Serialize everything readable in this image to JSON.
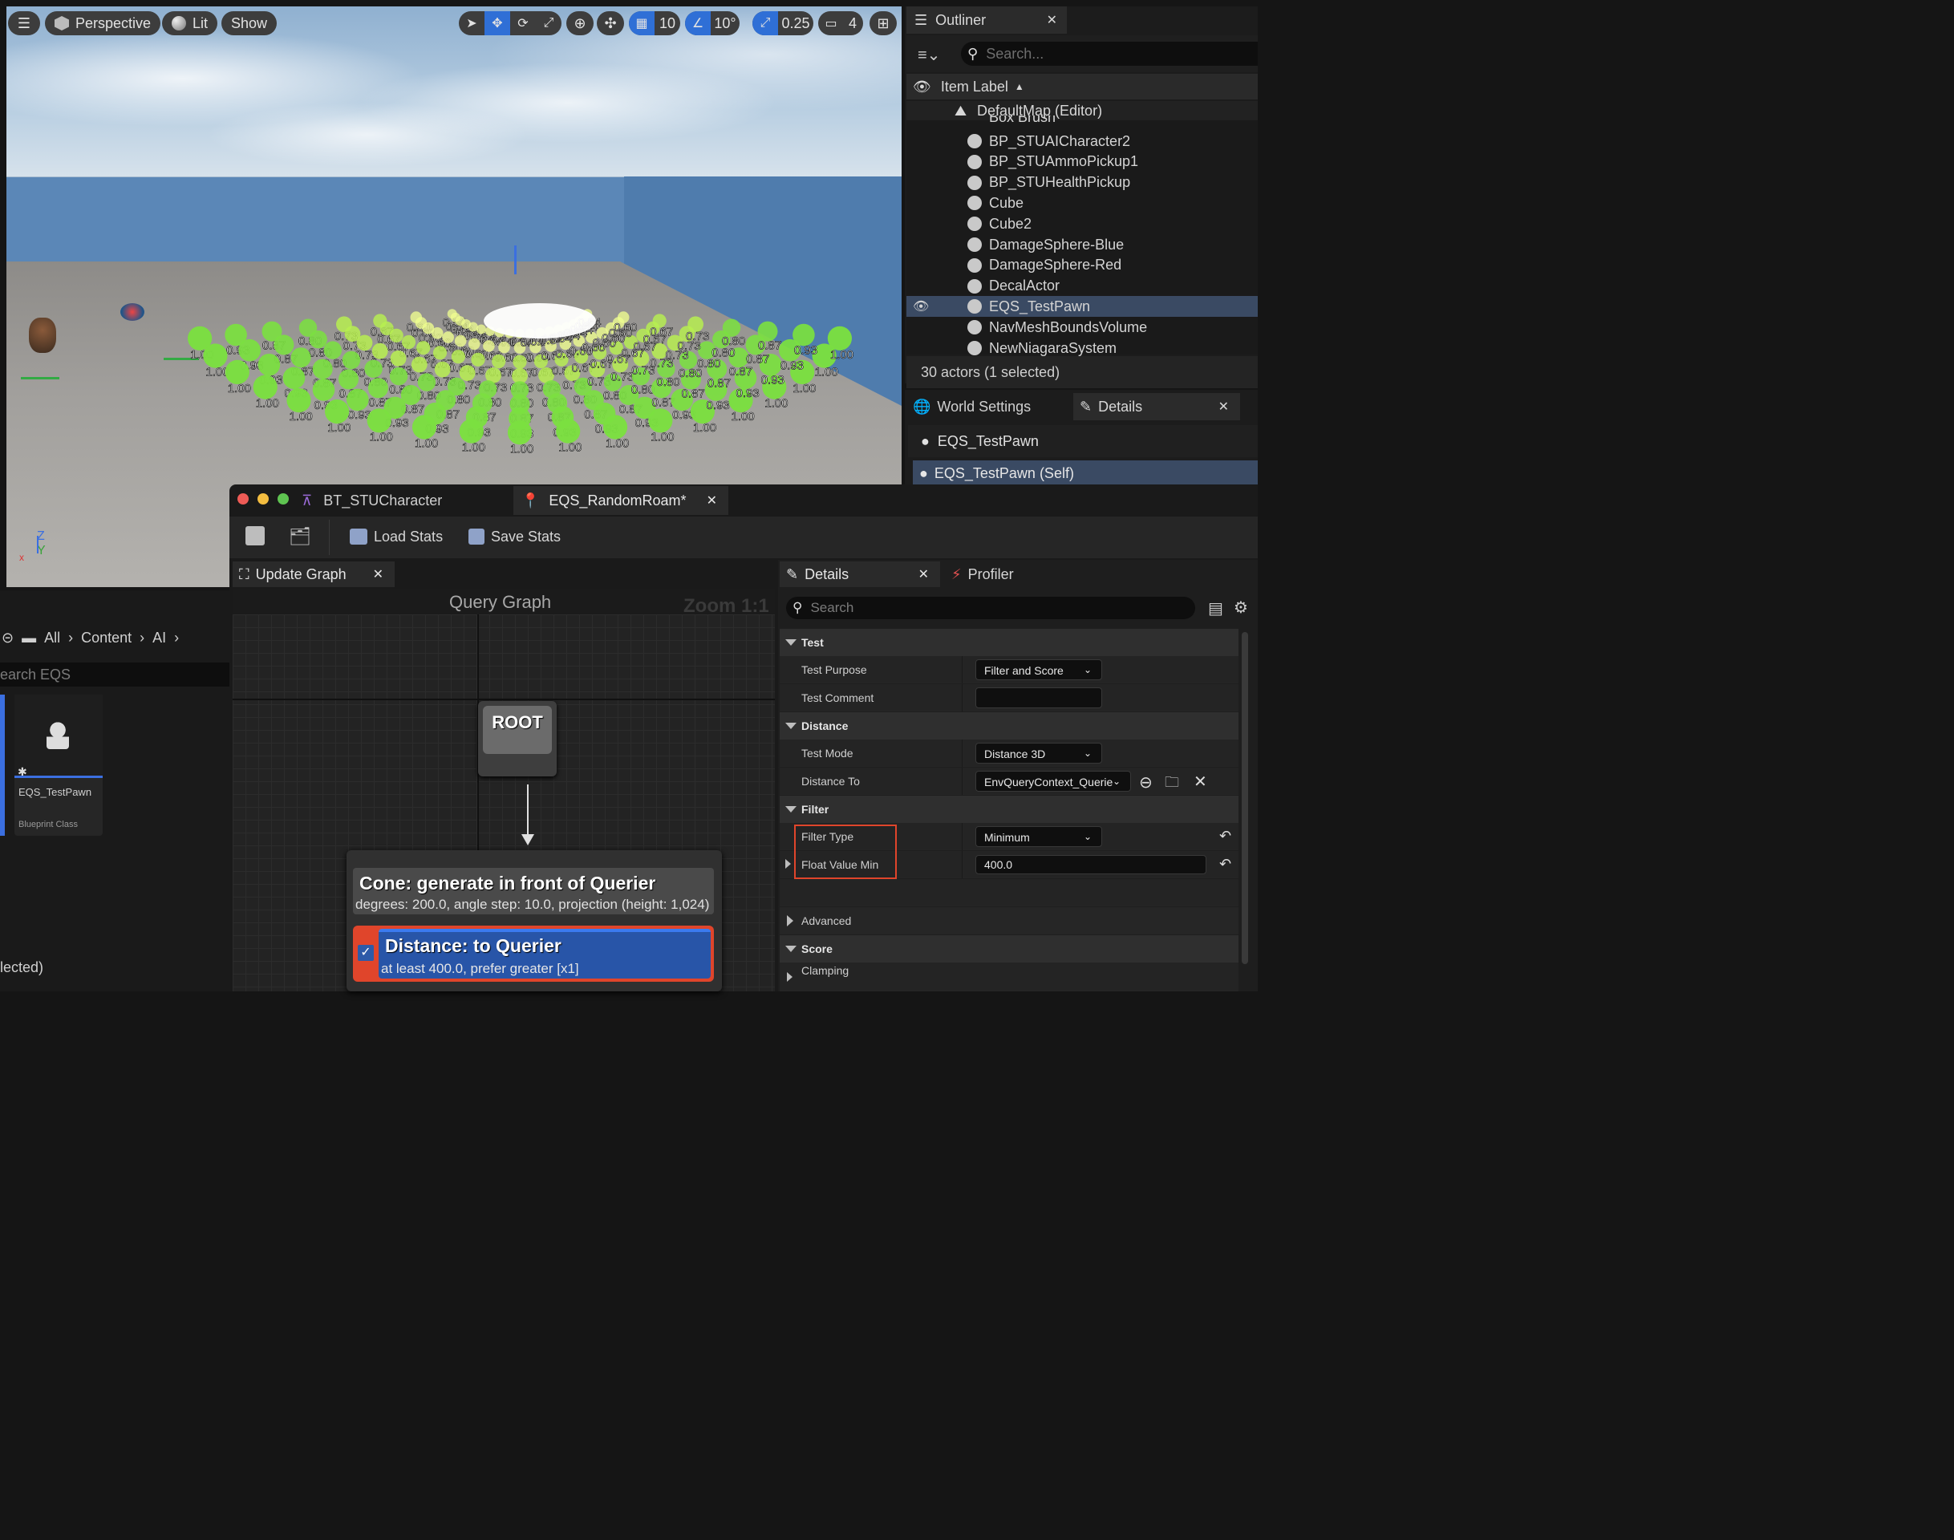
{
  "viewport": {
    "toolbar": {
      "perspective": "Perspective",
      "lit": "Lit",
      "show": "Show",
      "grid_snap": "10",
      "rot_snap": "10°",
      "scale_snap": "0.25",
      "camera_speed": "4"
    },
    "eqs_labels": [
      "1.00",
      "0.93",
      "0.87",
      "0.80",
      "0.73",
      "0.67",
      "0.60",
      "0.54",
      "0.47",
      "0.40"
    ],
    "axis": {
      "z": "Z",
      "y": "Y"
    }
  },
  "outliner": {
    "title": "Outliner",
    "search_placeholder": "Search...",
    "column_header": "Item Label",
    "map": "DefaultMap (Editor)",
    "partial_item": "Box Brush",
    "items": [
      "BP_STUAICharacter2",
      "BP_STUAmmoPickup1",
      "BP_STUHealthPickup",
      "Cube",
      "Cube2",
      "DamageSphere-Blue",
      "DamageSphere-Red",
      "DecalActor",
      "EQS_TestPawn",
      "NavMeshBoundsVolume",
      "NewNiagaraSystem"
    ],
    "selected_item": "EQS_TestPawn",
    "status": "30 actors (1 selected)"
  },
  "details_top": {
    "tab_world": "World Settings",
    "tab_details": "Details",
    "actor": "EQS_TestPawn",
    "component": "EQS_TestPawn (Self)"
  },
  "content_browser": {
    "breadcrumb": [
      "All",
      "Content",
      "AI"
    ],
    "search_placeholder": "earch EQS",
    "asset_name": "EQS_TestPawn",
    "asset_type": "Blueprint Class",
    "status": "lected)"
  },
  "eqs_editor": {
    "tabs": [
      "BT_STUCharacter",
      "EQS_RandomRoam*"
    ],
    "toolbar": {
      "load": "Load Stats",
      "save": "Save Stats"
    },
    "graph_tab": "Update Graph",
    "graph_title": "Query Graph",
    "zoom": "Zoom 1:1",
    "root": "ROOT",
    "generator_title": "Cone: generate in front of Querier",
    "generator_desc": "degrees: 200.0, angle step: 10.0, projection (height: 1,024)",
    "test_title": "Distance: to Querier",
    "test_desc": "at least 400.0, prefer greater [x1]"
  },
  "details_panel": {
    "tab_details": "Details",
    "tab_profiler": "Profiler",
    "search_placeholder": "Search",
    "categories": {
      "test": "Test",
      "distance": "Distance",
      "filter": "Filter",
      "advanced": "Advanced",
      "score": "Score"
    },
    "rows": {
      "test_purpose": {
        "label": "Test Purpose",
        "value": "Filter and Score"
      },
      "test_comment": {
        "label": "Test Comment",
        "value": ""
      },
      "test_mode": {
        "label": "Test Mode",
        "value": "Distance 3D"
      },
      "distance_to": {
        "label": "Distance To",
        "value": "EnvQueryContext_Querie"
      },
      "filter_type": {
        "label": "Filter Type",
        "value": "Minimum"
      },
      "float_value_min": {
        "label": "Float Value Min",
        "value": "400.0"
      },
      "clamping": {
        "label": "Clamping"
      }
    }
  },
  "colors": {
    "accent": "#2f6fd6",
    "selection": "#3a4a63",
    "highlight_box": "#e0452b",
    "test_node": "#2855a8"
  }
}
